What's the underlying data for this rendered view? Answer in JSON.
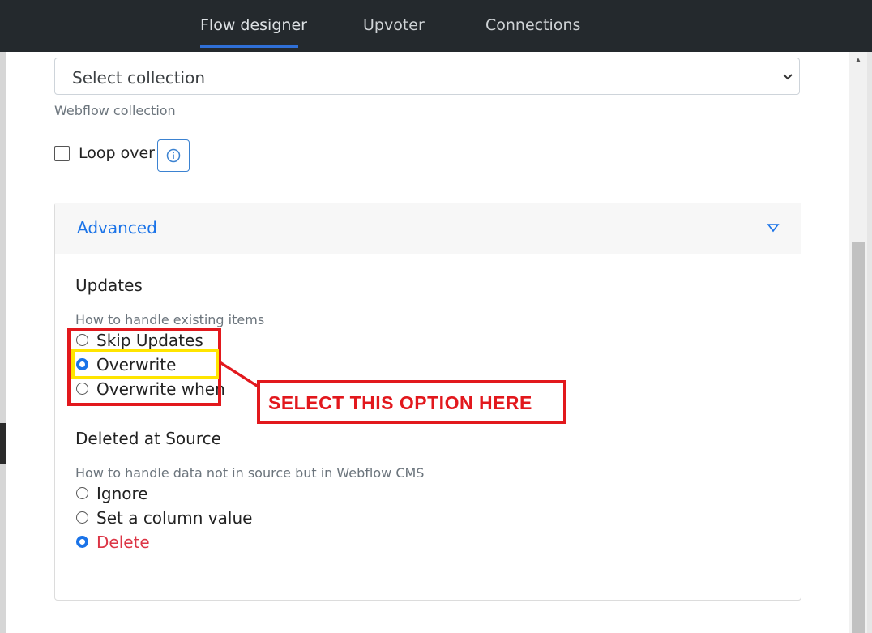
{
  "nav": {
    "tabs": [
      {
        "label": "Flow designer",
        "active": true
      },
      {
        "label": "Upvoter",
        "active": false
      },
      {
        "label": "Connections",
        "active": false
      }
    ]
  },
  "collection": {
    "selected": "Select collection",
    "help": "Webflow collection"
  },
  "loop": {
    "label": "Loop over",
    "checked": false,
    "info_icon": "info-icon"
  },
  "advanced": {
    "title": "Advanced",
    "expanded": true,
    "updates": {
      "title": "Updates",
      "help": "How to handle existing items",
      "options": [
        {
          "label": "Skip Updates",
          "checked": false
        },
        {
          "label": "Overwrite",
          "checked": true
        },
        {
          "label": "Overwrite when",
          "checked": false
        }
      ]
    },
    "deleted": {
      "title": "Deleted at Source",
      "help": "How to handle data not in source but in Webflow CMS",
      "options": [
        {
          "label": "Ignore",
          "checked": false
        },
        {
          "label": "Set a column value",
          "checked": false
        },
        {
          "label": "Delete",
          "checked": true
        }
      ]
    }
  },
  "annotation": {
    "callout": "SELECT THIS OPTION HERE"
  },
  "colors": {
    "accent": "#1a73e8",
    "annotation_red": "#e2181d",
    "annotation_yellow": "#ffe500",
    "danger": "#dc3545",
    "topbar": "#24292d"
  }
}
